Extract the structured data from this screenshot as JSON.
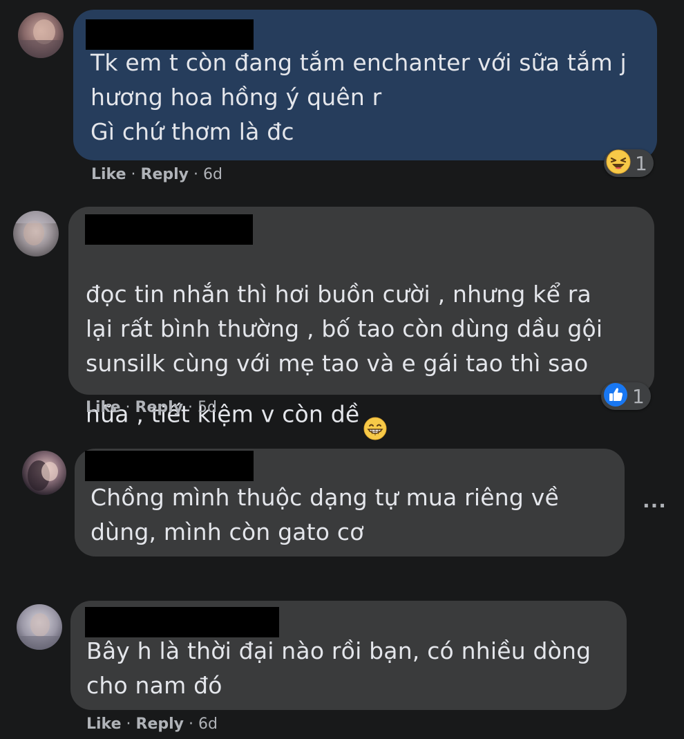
{
  "comments": [
    {
      "text": "Tk em t còn đang tắm enchanter với sữa tắm j\nhương hoa hồng ý quên r\nGì chứ thơm là đc",
      "like_label": "Like",
      "reply_label": "Reply",
      "time": "6d",
      "reaction": {
        "icon": "laughing-emoji-icon",
        "count": "1"
      }
    },
    {
      "text": "đọc tin nhắn thì hơi buồn cười , nhưng kể ra\nlại rất bình thường , bố tao còn dùng dầu gội\nsunsilk cùng với mẹ tao và e gái tao thì sao\nnữa , tiết kiệm v còn dề",
      "like_label": "Like",
      "reply_label": "Reply",
      "time": "5d",
      "reaction": {
        "icon": "thumbs-up-icon",
        "count": "1"
      }
    },
    {
      "text": "Chồng mình thuộc dạng tự mua riêng về\ndùng, mình còn gato cơ",
      "more_label": "..."
    },
    {
      "text": "Bây h là thời đại nào rồi bạn, có nhiều dòng\ncho nam đó",
      "like_label": "Like",
      "reply_label": "Reply",
      "time": "6d"
    }
  ],
  "colors": {
    "background": "#18191a",
    "bubble": "#3a3b3c",
    "bubble_highlight": "#263d5c",
    "text": "#e4e6eb",
    "secondary_text": "#b0b3b8",
    "like_blue": "#1877f2",
    "emoji_yellow": "#f7c948"
  }
}
